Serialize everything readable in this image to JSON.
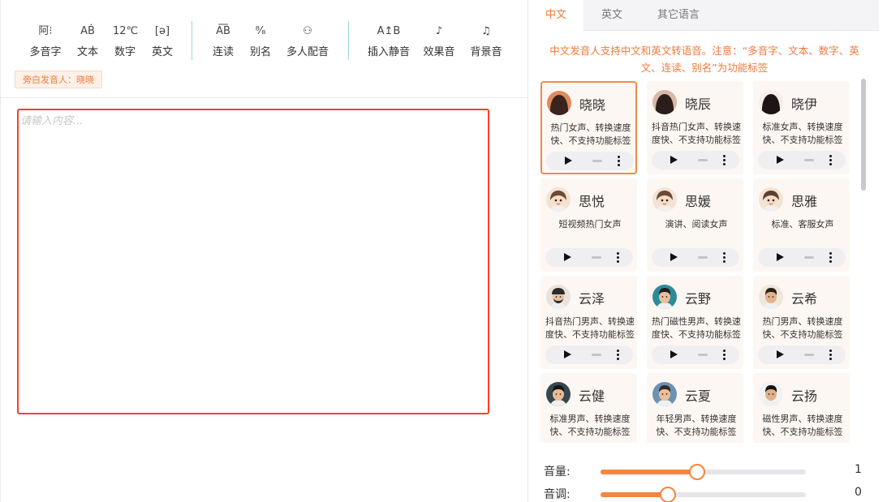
{
  "toolbar": {
    "tools": [
      {
        "icon": "阿﻿⁝",
        "label": "多音字",
        "name": "polyphone"
      },
      {
        "icon": "AḂ",
        "label": "文本",
        "name": "text"
      },
      {
        "icon": "12℃",
        "label": "数字",
        "name": "number"
      },
      {
        "icon": "[ə]",
        "label": "英文",
        "name": "english"
      },
      {
        "icon": "A͞B",
        "label": "连读",
        "name": "liaison"
      },
      {
        "icon": "⁸⁄₈",
        "label": "别名",
        "name": "alias"
      },
      {
        "icon": "⚇",
        "label": "多人配音",
        "name": "multi-voice"
      },
      {
        "icon": "A↥B",
        "label": "插入静音",
        "name": "insert-silence"
      },
      {
        "icon": "♪",
        "label": "效果音",
        "name": "sound-effect"
      },
      {
        "icon": "♫",
        "label": "背景音",
        "name": "background-music"
      }
    ],
    "narrator": "旁白发音人：晓晓"
  },
  "editor": {
    "placeholder": "请输入内容..."
  },
  "tabs": [
    {
      "label": "中文",
      "active": true
    },
    {
      "label": "英文",
      "active": false
    },
    {
      "label": "其它语言",
      "active": false
    }
  ],
  "notice": "中文发音人支持中文和英文转语音。注意：“多音字、文本、数字、英文、连读、别名”为功能标签",
  "voices": [
    {
      "name": "晓晓",
      "desc": "热门女声、转换速度快、不支持功能标签",
      "selected": true,
      "avatar": "female",
      "hair": "#3a2420",
      "skin": "#f3c9aa",
      "bg": "#e08a5c"
    },
    {
      "name": "晓辰",
      "desc": "抖音热门女声、转换速度快、不支持功能标签",
      "selected": false,
      "avatar": "female",
      "hair": "#2b1d1a",
      "skin": "#f5d3bd",
      "bg": "#d9b7a8"
    },
    {
      "name": "晓伊",
      "desc": "标准女声、转换速度快、不支持功能标签",
      "selected": false,
      "avatar": "female",
      "hair": "#1d1413",
      "skin": "#f1c7a4",
      "bg": "#f5efe9"
    },
    {
      "name": "思悦",
      "desc": "短视频热门女声",
      "selected": false,
      "avatar": "cartoon",
      "hair": "#6b4a36",
      "skin": "#f6dcc4",
      "bg": "#f3e3d4"
    },
    {
      "name": "思媛",
      "desc": "演讲、阅读女声",
      "selected": false,
      "avatar": "cartoon",
      "hair": "#6b4a36",
      "skin": "#f6dcc4",
      "bg": "#f3e3d4"
    },
    {
      "name": "思雅",
      "desc": "标准、客服女声",
      "selected": false,
      "avatar": "cartoon",
      "hair": "#5e4030",
      "skin": "#f6dcc4",
      "bg": "#f3e3d4"
    },
    {
      "name": "云泽",
      "desc": "抖音热门男声、转换速度快、不支持功能标签",
      "selected": false,
      "avatar": "beard",
      "hair": "#2b2b2b",
      "skin": "#e9c3a2",
      "bg": "#e7e2dc"
    },
    {
      "name": "云野",
      "desc": "热门磁性男声、转换速度快、不支持功能标签",
      "selected": false,
      "avatar": "male",
      "hair": "#1f1f1f",
      "skin": "#e9c09a",
      "bg": "#2e8c99"
    },
    {
      "name": "云希",
      "desc": "热门男声、转换速度快、不支持功能标签",
      "selected": false,
      "avatar": "male",
      "hair": "#2a2016",
      "skin": "#e2b38c",
      "bg": "#efe7db"
    },
    {
      "name": "云健",
      "desc": "标准男声、转换速度快、不支持功能标签",
      "selected": false,
      "avatar": "male",
      "hair": "#151515",
      "skin": "#e6bb96",
      "bg": "#37474f"
    },
    {
      "name": "云夏",
      "desc": "年轻男声、转换速度快、不支持功能标签",
      "selected": false,
      "avatar": "male",
      "hair": "#3a2a1e",
      "skin": "#e9c09a",
      "bg": "#6d90b5"
    },
    {
      "name": "云扬",
      "desc": "磁性男声、转换速度快、不支持功能标签",
      "selected": false,
      "avatar": "male",
      "hair": "#151515",
      "skin": "#e0b08a",
      "bg": "#f2f2f2"
    }
  ],
  "sliders": [
    {
      "label": "音量:",
      "value": "1",
      "fraction": 0.47
    },
    {
      "label": "音调:",
      "value": "0",
      "fraction": 0.33
    }
  ],
  "colors": {
    "accent": "#f07a3c",
    "selection": "#ff3b30",
    "divider": "#9fd3d6"
  }
}
